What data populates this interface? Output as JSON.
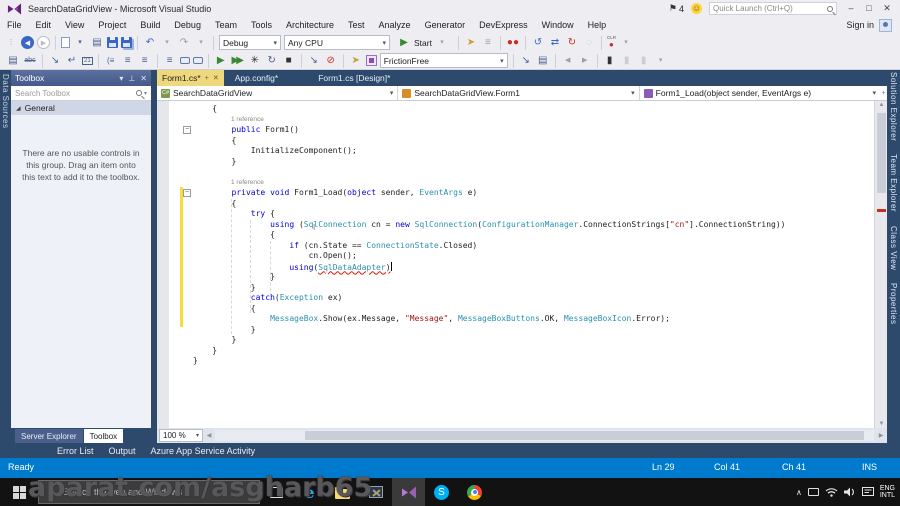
{
  "colors": {
    "accent_blue": "#007acc",
    "active_tab_gold": "#eed87e",
    "keyword_blue": "#0000e0",
    "type_teal": "#2b91af",
    "string_red": "#a31515",
    "change_bar_yellow": "#f5de3c",
    "error_red": "#e51400",
    "shell_blue": "#2d4a6d",
    "vs_purple": "#68217a"
  },
  "titlebar": {
    "title": "SearchDataGridView - Microsoft Visual Studio",
    "notification_count": "4",
    "quick_launch_placeholder": "Quick Launch (Ctrl+Q)"
  },
  "menubar": {
    "items": [
      "File",
      "Edit",
      "View",
      "Project",
      "Build",
      "Debug",
      "Team",
      "Tools",
      "Architecture",
      "Test",
      "Analyze",
      "Generator",
      "DevExpress",
      "Window",
      "Help"
    ],
    "sign_in": "Sign in"
  },
  "toolbar": {
    "configuration": "Debug",
    "platform": "Any CPU",
    "start": "Start",
    "profile": "FrictionFree",
    "clr_label": "CLR",
    "box21": "21"
  },
  "left_strip": {
    "tab": "Data Sources"
  },
  "right_strip": {
    "tabs": [
      "Solution Explorer",
      "Team Explorer",
      "Class View",
      "Properties"
    ]
  },
  "toolbox": {
    "title": "Toolbox",
    "search_placeholder": "Search Toolbox",
    "section_general": "General",
    "empty_message": "There are no usable controls in this group. Drag an item onto this text to add it to the toolbox.",
    "bottom_tabs": [
      "Server Explorer",
      "Toolbox"
    ]
  },
  "editor": {
    "tabs": [
      "Form1.cs*",
      "App.config*",
      "Form1.cs [Design]*"
    ],
    "nav_project": "SearchDataGridView",
    "nav_type": "SearchDataGridView.Form1",
    "nav_member": "Form1_Load(object sender, EventArgs e)",
    "zoom_level": "100 %",
    "code_lines": [
      [
        [
          "p",
          "    {"
        ]
      ],
      [
        [
          "cl",
          "1 reference"
        ]
      ],
      [
        [
          "p",
          "        "
        ],
        [
          "k",
          "public"
        ],
        [
          "p",
          " Form1()"
        ]
      ],
      [
        [
          "p",
          "        {"
        ]
      ],
      [
        [
          "p",
          "            InitializeComponent();"
        ]
      ],
      [
        [
          "p",
          "        }"
        ]
      ],
      [],
      [
        [
          "cl",
          "1 reference"
        ]
      ],
      [
        [
          "p",
          "        "
        ],
        [
          "k",
          "private"
        ],
        [
          "p",
          " "
        ],
        [
          "k",
          "void"
        ],
        [
          "p",
          " Form1_Load("
        ],
        [
          "k",
          "object"
        ],
        [
          "p",
          " sender, "
        ],
        [
          "t",
          "EventArgs"
        ],
        [
          "p",
          " e)"
        ]
      ],
      [
        [
          "p",
          "        {"
        ]
      ],
      [
        [
          "p",
          "            "
        ],
        [
          "k",
          "try"
        ],
        [
          "p",
          " {"
        ]
      ],
      [
        [
          "p",
          "                "
        ],
        [
          "k",
          "using"
        ],
        [
          "p",
          " ("
        ],
        [
          "t",
          "SqlConnection"
        ],
        [
          "p",
          " cn = "
        ],
        [
          "k",
          "new"
        ],
        [
          "p",
          " "
        ],
        [
          "t",
          "SqlConnection"
        ],
        [
          "p",
          "("
        ],
        [
          "t",
          "ConfigurationManager"
        ],
        [
          "p",
          ".ConnectionStrings["
        ],
        [
          "s",
          "\"cn\""
        ],
        [
          "p",
          "].ConnectionString))"
        ]
      ],
      [
        [
          "p",
          "                {"
        ]
      ],
      [
        [
          "p",
          "                    "
        ],
        [
          "k",
          "if"
        ],
        [
          "p",
          " (cn.State == "
        ],
        [
          "t",
          "ConnectionState"
        ],
        [
          "p",
          ".Closed)"
        ]
      ],
      [
        [
          "p",
          "                        cn.Open();"
        ]
      ],
      [
        [
          "p",
          "                    "
        ],
        [
          "k",
          "using"
        ],
        [
          "p",
          "("
        ],
        [
          "te",
          "SqlDataAdapter"
        ],
        [
          "pe",
          ")"
        ],
        [
          "caret",
          ""
        ]
      ],
      [
        [
          "p",
          "                }"
        ]
      ],
      [
        [
          "p",
          "            }"
        ]
      ],
      [
        [
          "p",
          "            "
        ],
        [
          "k",
          "catch"
        ],
        [
          "p",
          "("
        ],
        [
          "t",
          "Exception"
        ],
        [
          "p",
          " ex)"
        ]
      ],
      [
        [
          "p",
          "            {"
        ]
      ],
      [
        [
          "p",
          "                "
        ],
        [
          "t",
          "MessageBox"
        ],
        [
          "p",
          ".Show(ex.Message, "
        ],
        [
          "s",
          "\"Message\""
        ],
        [
          "p",
          ", "
        ],
        [
          "t",
          "MessageBoxButtons"
        ],
        [
          "p",
          ".OK, "
        ],
        [
          "t",
          "MessageBoxIcon"
        ],
        [
          "p",
          ".Error);"
        ]
      ],
      [
        [
          "p",
          "            }"
        ]
      ],
      [
        [
          "p",
          "        }"
        ]
      ],
      [
        [
          "p",
          "    }"
        ]
      ],
      [
        [
          "p",
          "}"
        ]
      ]
    ]
  },
  "bottom_panel": {
    "tabs": [
      "Error List",
      "Output",
      "Azure App Service Activity"
    ]
  },
  "statusbar": {
    "message": "Ready",
    "line": "Ln 29",
    "column": "Col 41",
    "character": "Ch 41",
    "mode": "INS"
  },
  "taskbar": {
    "search_placeholder": "Search the web and Windows",
    "language_top": "ENG",
    "language_bottom": "INTL"
  },
  "watermark": "aparat.com/asgharb65",
  "icons": {
    "dropdown": "▾",
    "close": "✕",
    "pin": "⊥",
    "tab-pin": "+",
    "minimize": "–",
    "maximize": "□",
    "back": "◀",
    "forward": "▶",
    "play": "▶",
    "stop": "■",
    "undo": "↶",
    "redo": "↷",
    "enter": "↵",
    "menu-lines": "≡",
    "blocked": "⊘",
    "flag": "⚑",
    "smiley": "☺",
    "expand": "◢",
    "chevron-up": "∧",
    "bookmark": "▮",
    "refresh": "↻",
    "splitter": "+",
    "up": "▲",
    "down": "▼",
    "left": "◀",
    "right": "▶",
    "doc": "▤",
    "strike": "abc",
    "burst": "✳",
    "goto": "↘",
    "pointer": "➤",
    "paren": "(≡",
    "swap": "⇄",
    "loop": "↺",
    "dashed-circle": "◌",
    "dot": "●",
    "grip": "⋮",
    "ibeam": "I",
    "minus": "−"
  }
}
